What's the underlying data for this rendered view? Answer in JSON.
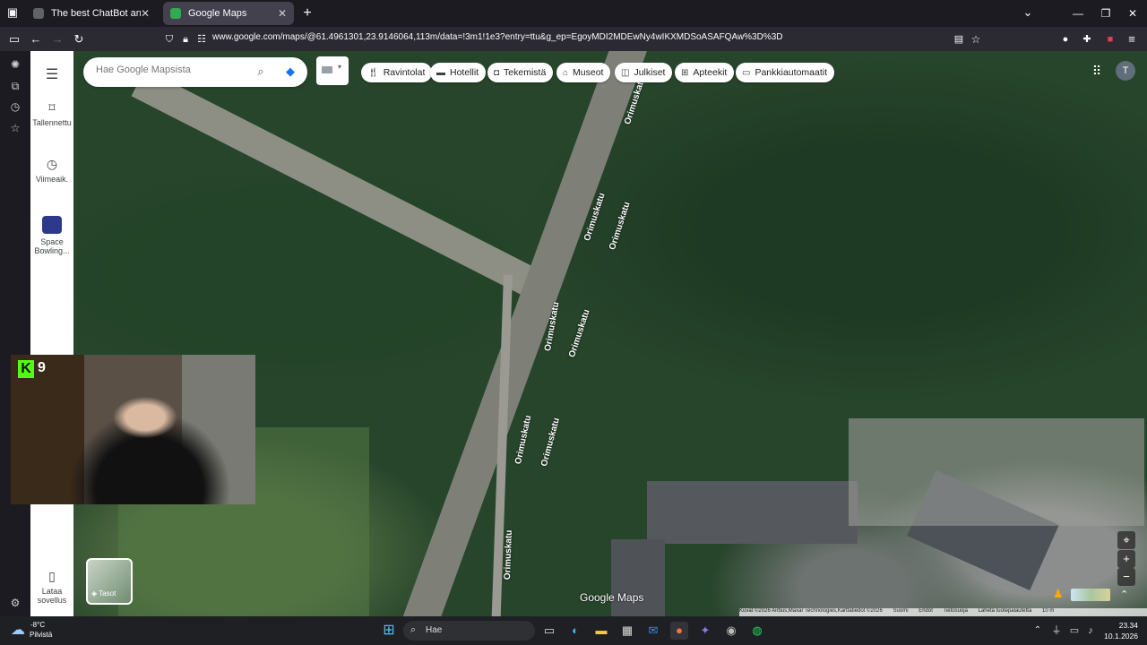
{
  "browser": {
    "tabs": [
      {
        "title": "The best ChatBot and Widgets",
        "active": false
      },
      {
        "title": "Google Maps",
        "active": true
      }
    ],
    "url": "www.google.com/maps/@61.4961301,23.9146064,113m/data=!3m1!1e3?entry=ttu&g_ep=EgoyMDI2MDEwNy4wIKXMDSoASAFQAw%3D%3D",
    "new_tab": "+",
    "dropdown": "⌄"
  },
  "maps": {
    "search_placeholder": "Hae Google Mapsista",
    "rail": [
      {
        "label": "Tallennettu",
        "icon": "bookmark-icon"
      },
      {
        "label": "Viimeaik.",
        "icon": "history-icon"
      },
      {
        "label": "Space Bowling...",
        "icon": "place-thumb"
      },
      {
        "label": "Lataa sovellus",
        "icon": "phone-icon"
      }
    ],
    "chips": [
      {
        "label": "Ravintolat",
        "icon": "restaurant-icon"
      },
      {
        "label": "Hotellit",
        "icon": "hotel-icon"
      },
      {
        "label": "Tekemistä",
        "icon": "camera-icon"
      },
      {
        "label": "Museot",
        "icon": "museum-icon"
      },
      {
        "label": "Julkiset",
        "icon": "transit-icon"
      },
      {
        "label": "Apteekit",
        "icon": "pharmacy-icon"
      },
      {
        "label": "Pankkiautomaatit",
        "icon": "atm-icon"
      }
    ],
    "avatar_letter": "T",
    "road_name": "Orimuskatu",
    "layers_label": "Tasot",
    "logo": "Google Maps",
    "attribution": [
      "Kuvat ©2026 Airbus,Maxar Technologies,Karttatiedot ©2026",
      "Suomi",
      "Ehdot",
      "Tietosuoja",
      "Lähetä tuotepalautetta",
      "10 m"
    ]
  },
  "stream": {
    "badge": "K",
    "number": "9"
  },
  "taskbar": {
    "weather_temp": "-8°C",
    "weather_desc": "Pilvistä",
    "search_label": "Hae",
    "time": "23.34",
    "date": "10.1.2026"
  },
  "colors": {
    "accent": "#1a73e8",
    "kick": "#53fc18"
  }
}
